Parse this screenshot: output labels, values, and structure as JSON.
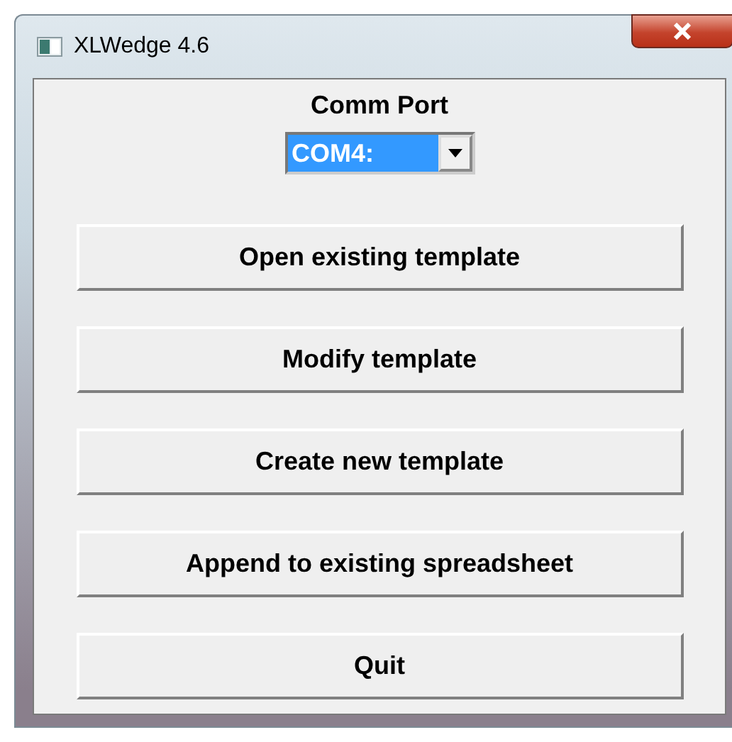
{
  "window": {
    "title": "XLWedge 4.6"
  },
  "comm_port": {
    "label": "Comm Port",
    "value": "COM4:"
  },
  "buttons": [
    "Open existing template",
    "Modify template",
    "Create new template",
    "Append to existing spreadsheet",
    "Quit"
  ]
}
